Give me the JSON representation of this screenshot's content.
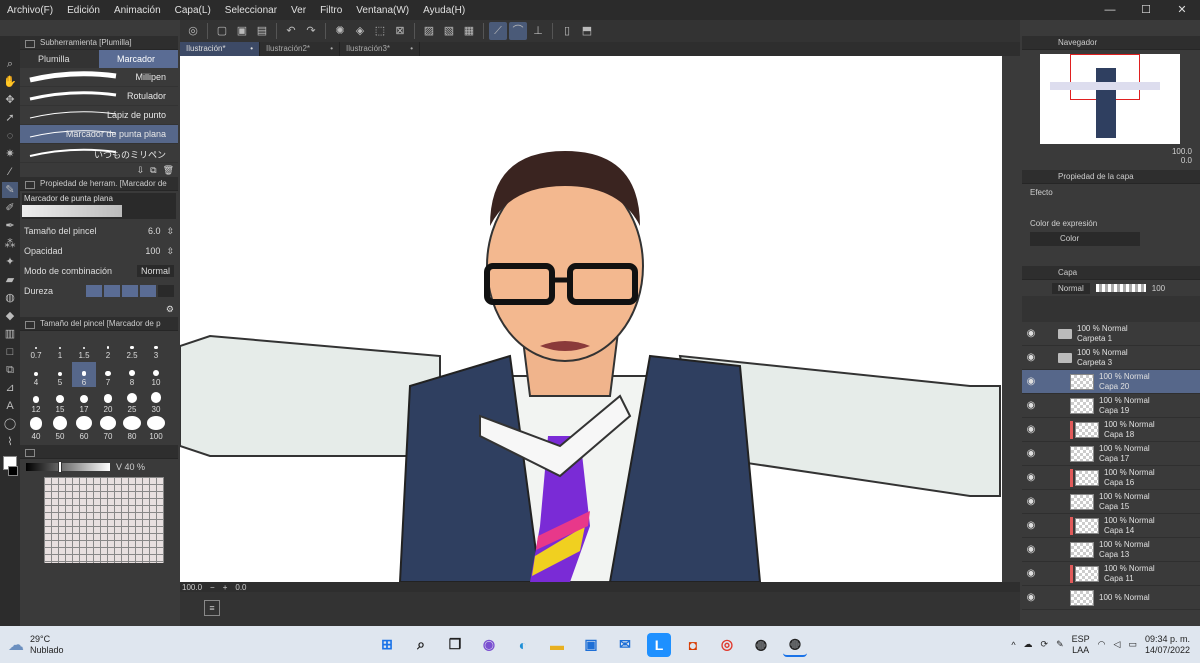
{
  "menu": [
    "Archivo(F)",
    "Edición",
    "Animación",
    "Capa(L)",
    "Seleccionar",
    "Ver",
    "Filtro",
    "Ventana(W)",
    "Ayuda(H)"
  ],
  "tabs": [
    "Ilustración*",
    "Ilustración2*",
    "Ilustración3*"
  ],
  "subtool": {
    "header": "Subherramienta [Plumilla]",
    "tab1": "Plumilla",
    "tab2": "Marcador",
    "brushes": [
      "Millipen",
      "Rotulador",
      "Lápiz de punto",
      "Marcador de punta plana",
      "いつものミリペン"
    ]
  },
  "toolprop": {
    "header": "Propiedad de herram. [Marcador de",
    "preview_label": "Marcador de punta plana",
    "size_label": "Tamaño del pincel",
    "size_value": "6.0",
    "opacity_label": "Opacidad",
    "opacity_value": "100",
    "blend_label": "Modo de combinación",
    "blend_value": "Normal",
    "hardness_label": "Dureza"
  },
  "brushsize": {
    "header": "Tamaño del pincel [Marcador de p",
    "sizes": [
      "0.7",
      "1",
      "1.5",
      "2",
      "2.5",
      "3",
      "4",
      "5",
      "6",
      "7",
      "8",
      "10",
      "12",
      "15",
      "17",
      "20",
      "25",
      "30",
      "40",
      "50",
      "60",
      "70",
      "80",
      "100"
    ],
    "selected": "6"
  },
  "color": {
    "v_label": "V 40 %",
    "v_value": 40,
    "foreground": "#ffffff",
    "background": "#000000"
  },
  "statusbar": {
    "zoom": "100.0",
    "angle": "0.0"
  },
  "navigator": {
    "header": "Navegador",
    "zoom": "100.0",
    "rotate": "0.0"
  },
  "layerprop": {
    "header": "Propiedad de la capa",
    "effect_label": "Efecto",
    "expr_label": "Color de expresión",
    "expr_value": "Color"
  },
  "layers": {
    "header": "Capa",
    "blend": "Normal",
    "opacity": "100",
    "items": [
      {
        "pct": "100 % Normal",
        "name": "Carpeta 1",
        "type": "folder",
        "sel": false,
        "red": false,
        "indent": 0
      },
      {
        "pct": "100 % Normal",
        "name": "Carpeta 3",
        "type": "folder",
        "sel": false,
        "red": false,
        "indent": 0
      },
      {
        "pct": "100 % Normal",
        "name": "Capa 20",
        "type": "layer",
        "sel": true,
        "red": false,
        "indent": 1
      },
      {
        "pct": "100 % Normal",
        "name": "Capa 19",
        "type": "layer",
        "sel": false,
        "red": false,
        "indent": 1
      },
      {
        "pct": "100 % Normal",
        "name": "Capa 18",
        "type": "layer",
        "sel": false,
        "red": true,
        "indent": 1
      },
      {
        "pct": "100 % Normal",
        "name": "Capa 17",
        "type": "layer",
        "sel": false,
        "red": false,
        "indent": 1
      },
      {
        "pct": "100 % Normal",
        "name": "Capa 16",
        "type": "layer",
        "sel": false,
        "red": true,
        "indent": 1
      },
      {
        "pct": "100 % Normal",
        "name": "Capa 15",
        "type": "layer",
        "sel": false,
        "red": false,
        "indent": 1
      },
      {
        "pct": "100 % Normal",
        "name": "Capa 14",
        "type": "layer",
        "sel": false,
        "red": true,
        "indent": 1
      },
      {
        "pct": "100 % Normal",
        "name": "Capa 13",
        "type": "layer",
        "sel": false,
        "red": false,
        "indent": 1
      },
      {
        "pct": "100 % Normal",
        "name": "Capa 11",
        "type": "layer",
        "sel": false,
        "red": true,
        "indent": 1
      },
      {
        "pct": "100 % Normal",
        "name": "",
        "type": "layer",
        "sel": false,
        "red": false,
        "indent": 1
      }
    ]
  },
  "taskbar": {
    "temp": "29°C",
    "weather": "Nublado",
    "lang1": "ESP",
    "lang2": "LAA",
    "time": "09:34 p. m.",
    "date": "14/07/2022"
  }
}
